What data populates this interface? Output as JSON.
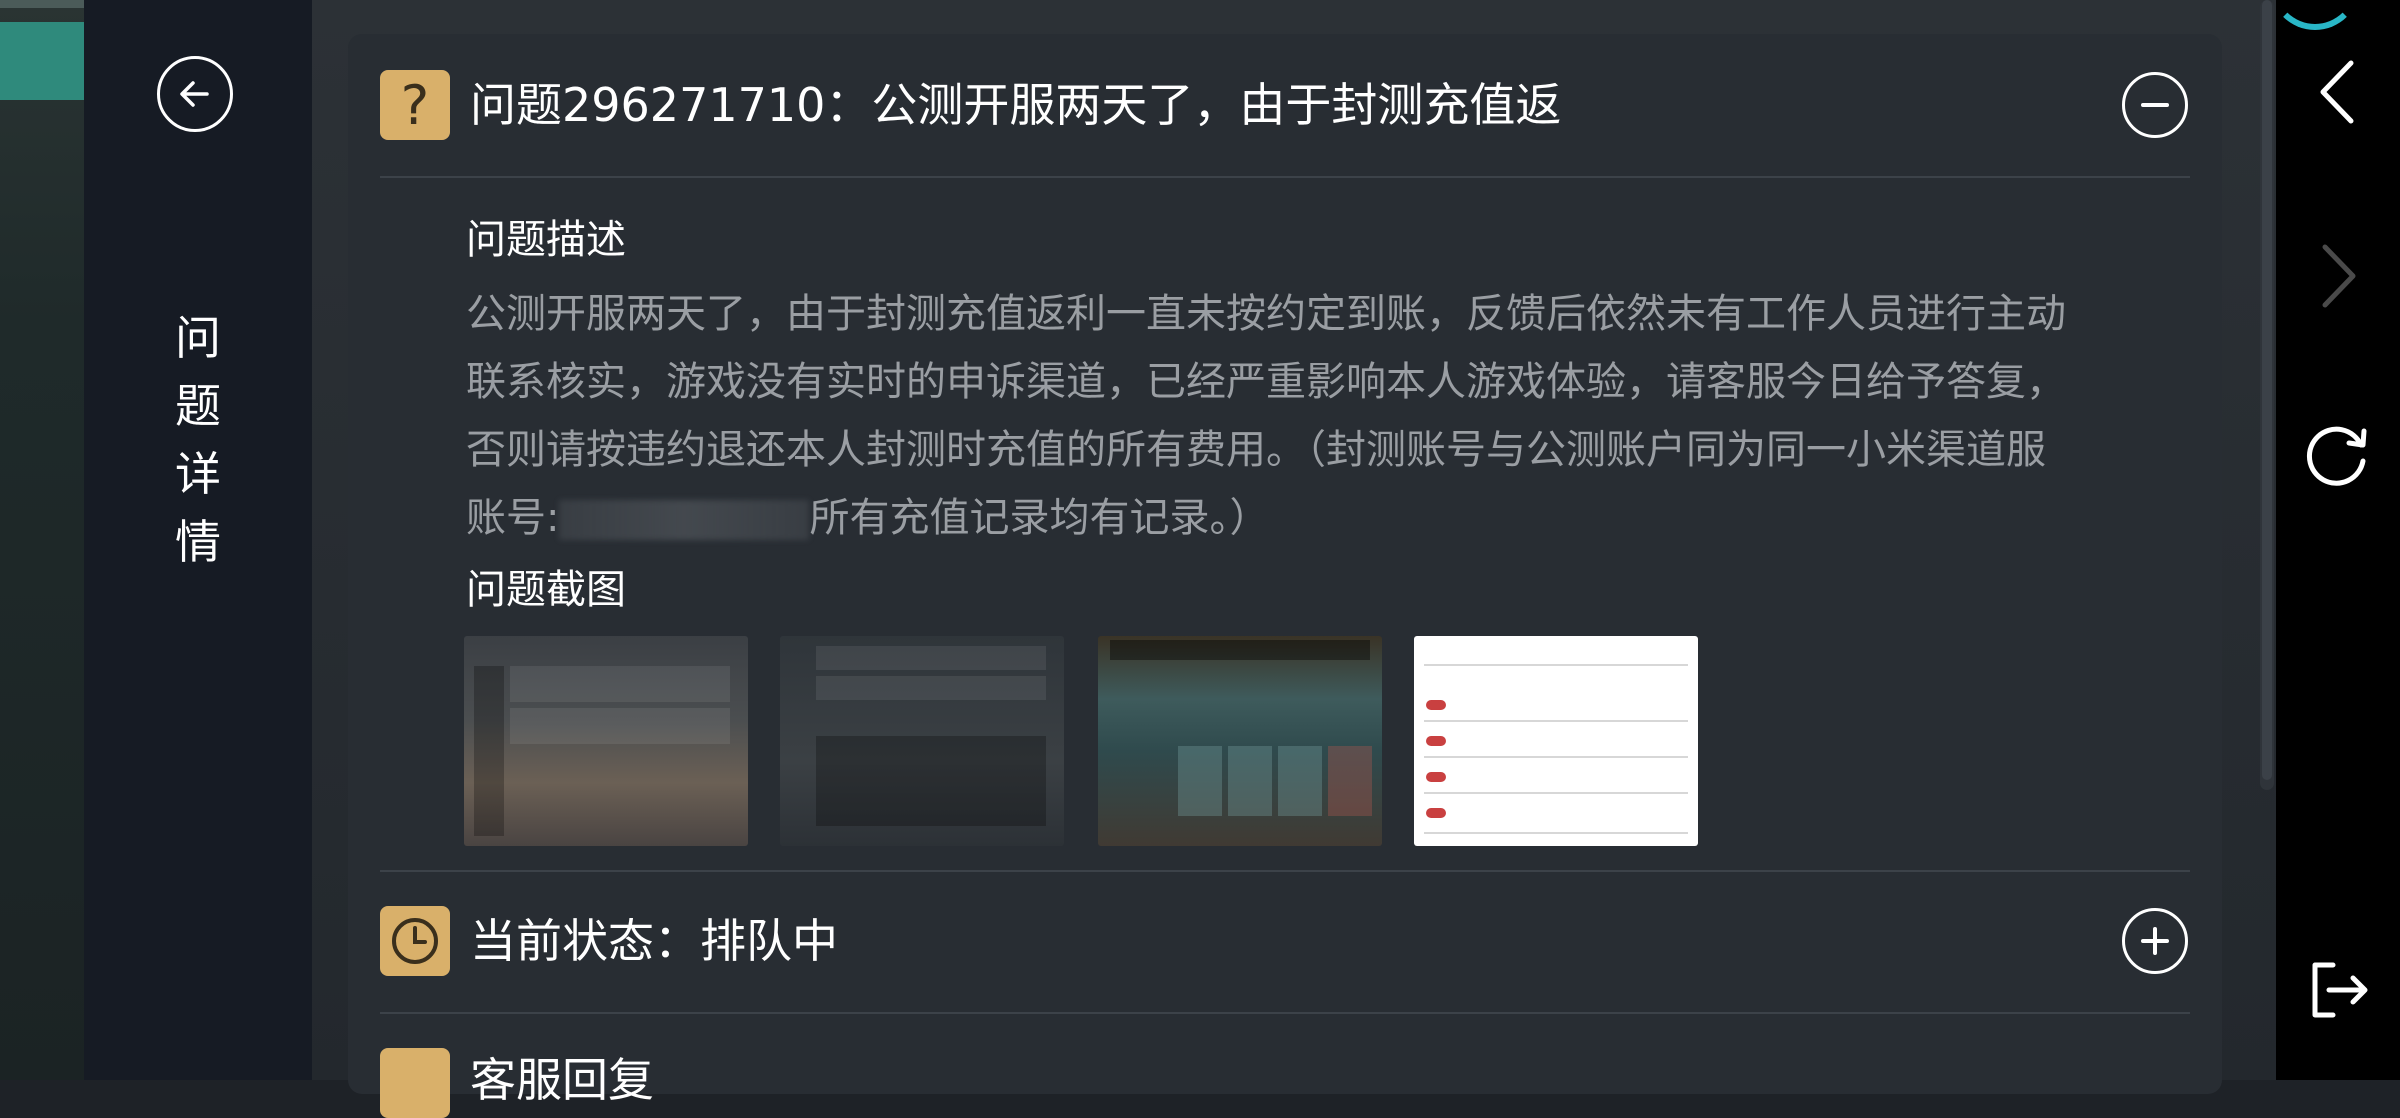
{
  "sidebar": {
    "title": "问题详情",
    "title_chars": [
      "问",
      "题",
      "详",
      "情"
    ]
  },
  "question": {
    "title": "问题296271710：公测开服两天了，由于封测充值返",
    "collapse_icon": "minus-circle-icon"
  },
  "description": {
    "label": "问题描述",
    "text_before_redaction": "公测开服两天了，由于封测充值返利一直未按约定到账，反馈后依然未有工作人员进行主动联系核实，游戏没有实时的申诉渠道，已经严重影响本人游戏体验，请客服今日给予答复，否则请按违约退还本人封测时充值的所有费用。（封测账号与公测账户同为同一小米渠道服账号:",
    "text_after_redaction": "所有充值记录均有记录。）"
  },
  "screenshots": {
    "label": "问题截图",
    "items": [
      "screenshot-1",
      "screenshot-2",
      "screenshot-3",
      "screenshot-4"
    ]
  },
  "status": {
    "text": "当前状态：排队中",
    "expand_icon": "plus-circle-icon"
  },
  "reply": {
    "text": "客服回复"
  },
  "colors": {
    "accent": "#d9b06a",
    "panel": "#282d33",
    "sidebar": "#161b24",
    "muted_text": "#9a9ea3",
    "nav": "#000000",
    "arc": "#29b7c7"
  },
  "nav": {
    "icons": [
      "chevron-left-icon",
      "chevron-right-icon",
      "refresh-icon",
      "exit-icon"
    ]
  }
}
